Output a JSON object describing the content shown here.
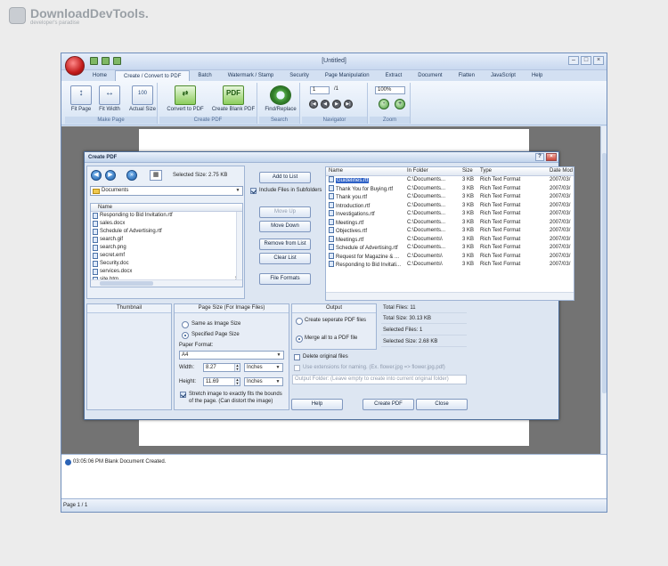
{
  "watermark": {
    "title": "DownloadDevTools.",
    "subtitle": "developer's paradise"
  },
  "app": {
    "title": "[Untitled]",
    "tabs": [
      "Home",
      "Create / Convert to PDF",
      "Batch",
      "Watermark / Stamp",
      "Security",
      "Page Manipulation",
      "Extract",
      "Document",
      "Flatten",
      "JavaScript",
      "Help"
    ],
    "active_tab": "Create / Convert to PDF"
  },
  "ribbon": {
    "make_page": {
      "label": "Make Page",
      "fit_page": "Fit Page",
      "fit_width": "Fit Width",
      "actual_size": "Actual Size"
    },
    "create_pdf": {
      "label": "Create PDF",
      "convert": "Convert to PDF",
      "create_blank": "Create Blank PDF"
    },
    "search": {
      "label": "Search",
      "find_replace": "Find/Replace"
    },
    "navigator": {
      "label": "Navigator",
      "page_value": "1",
      "of_text": "/1"
    },
    "zoom": {
      "label": "Zoom",
      "value": "100%"
    }
  },
  "log": {
    "message": "03:05:06 PM Blank Document Created."
  },
  "statusbar": {
    "page": "Page 1 / 1"
  },
  "dialog": {
    "title": "Create PDF",
    "selected_size_label": "Selected Size: 2.75 KB",
    "folder": "Documents",
    "left_list_header": "Name",
    "left_files": [
      {
        "name": "Responding to Bid Invitation.rtf",
        "size": ":"
      },
      {
        "name": "sales.docx",
        "size": "1:"
      },
      {
        "name": "Schedule of Advertising.rtf",
        "size": ":"
      },
      {
        "name": "search.gif",
        "size": ":"
      },
      {
        "name": "search.png",
        "size": ":"
      },
      {
        "name": "secret.emf",
        "size": "5:"
      },
      {
        "name": "Security.doc",
        "size": "2:"
      },
      {
        "name": "services.docx",
        "size": ":"
      },
      {
        "name": "site.htm",
        "size": "28:"
      }
    ],
    "buttons": {
      "add_to_list": "Add to List",
      "include_subfolders": "Include Files in Subfolders",
      "move_up": "Move Up",
      "move_down": "Move Down",
      "remove_from_list": "Remove from List",
      "clear_list": "Clear List",
      "file_formats": "File Formats",
      "help": "Help",
      "create_pdf": "Create PDF",
      "close": "Close"
    },
    "grid_headers": [
      "Name",
      "In Folder",
      "Size",
      "Type",
      "Date Mod"
    ],
    "grid_rows": [
      [
        "Guidelines.rtf",
        "C:\\Documents...",
        "3 KB",
        "Rich Text Format",
        "2007/03/"
      ],
      [
        "Thank You for Buying.rtf",
        "C:\\Documents...",
        "3 KB",
        "Rich Text Format",
        "2007/03/"
      ],
      [
        "Thank you.rtf",
        "C:\\Documents...",
        "3 KB",
        "Rich Text Format",
        "2007/03/"
      ],
      [
        "Introduction.rtf",
        "C:\\Documents...",
        "3 KB",
        "Rich Text Format",
        "2007/03/"
      ],
      [
        "Investigations.rtf",
        "C:\\Documents...",
        "3 KB",
        "Rich Text Format",
        "2007/03/"
      ],
      [
        "Meetings.rtf",
        "C:\\Documents...",
        "3 KB",
        "Rich Text Format",
        "2007/03/"
      ],
      [
        "Objectives.rtf",
        "C:\\Documents...",
        "3 KB",
        "Rich Text Format",
        "2007/03/"
      ],
      [
        "Meetings.rtf",
        "C:\\Documents\\",
        "3 KB",
        "Rich Text Format",
        "2007/03/"
      ],
      [
        "Schedule of Advertising.rtf",
        "C:\\Documents...",
        "3 KB",
        "Rich Text Format",
        "2007/03/"
      ],
      [
        "Request for Magazine & ...",
        "C:\\Documents\\",
        "3 KB",
        "Rich Text Format",
        "2007/03/"
      ],
      [
        "Responding to Bid Invitati...",
        "C:\\Documents\\",
        "3 KB",
        "Rich Text Format",
        "2007/03/"
      ]
    ],
    "thumbnail_label": "Thumbnail",
    "page_size": {
      "title": "Page Size (For Image Files)",
      "same_as_image": "Same as Image Size",
      "specified": "Specified Page Size",
      "paper_format_label": "Paper Format:",
      "paper_format": "A4",
      "width_label": "Width:",
      "width": "8.27",
      "width_unit": "Inches",
      "height_label": "Height:",
      "height": "11.69",
      "height_unit": "Inches",
      "stretch": "Stretch image to exactly fits the bounds of the page. (Can distort the image)"
    },
    "output": {
      "title": "Output",
      "separate": "Create seperate PDF files",
      "merge": "Merge all to a PDF file",
      "delete_original": "Delete original files",
      "use_extensions": "Use extensions for naming. (Ex. flower.jpg => flower.jpg.pdf)",
      "output_folder_placeholder": "Output Folder: (Leave empty to create into current original folder)"
    },
    "stats": {
      "total_files": "Total Files: 11",
      "total_size": "Total Size: 30.13 KB",
      "selected_files": "Selected Files: 1",
      "selected_size": "Selected Size: 2.68 KB"
    }
  }
}
